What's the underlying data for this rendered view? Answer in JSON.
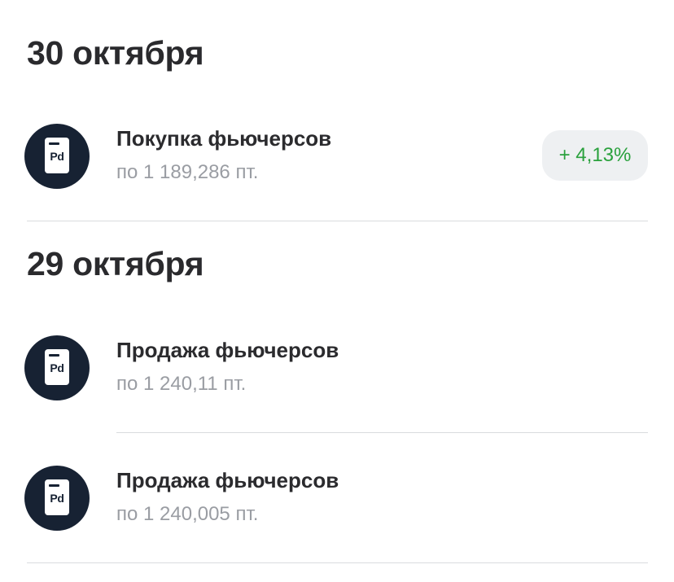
{
  "groups": [
    {
      "date": "30 октября",
      "operations": [
        {
          "icon": "pd-document-icon",
          "icon_text": "Pd",
          "title": "Покупка фьючерсов",
          "subtitle": "по 1 189,286 пт.",
          "change": "+ 4,13%",
          "change_color": "#2aa13d"
        }
      ]
    },
    {
      "date": "29 октября",
      "operations": [
        {
          "icon": "pd-document-icon",
          "icon_text": "Pd",
          "title": "Продажа фьючерсов",
          "subtitle": "по 1 240,11 пт."
        },
        {
          "icon": "pd-document-icon",
          "icon_text": "Pd",
          "title": "Продажа фьючерсов",
          "subtitle": "по 1 240,005 пт."
        }
      ]
    }
  ],
  "colors": {
    "avatar_background": "#172233",
    "positive_change": "#2aa13d",
    "badge_background": "#eef0f2"
  }
}
